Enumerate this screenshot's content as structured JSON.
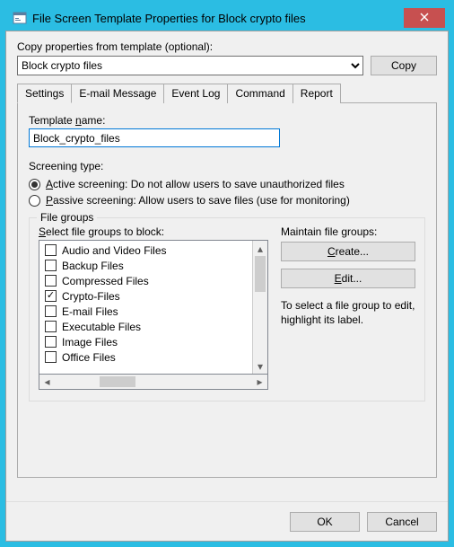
{
  "title": "File Screen Template Properties for Block crypto files",
  "copy_section": {
    "label": "Copy properties from template (optional):",
    "selected": "Block crypto files",
    "button": "Copy"
  },
  "tabs": [
    "Settings",
    "E-mail Message",
    "Event Log",
    "Command",
    "Report"
  ],
  "active_tab": "Settings",
  "settings": {
    "template_name_label": "Template name:",
    "template_name_value": "Block_crypto_files",
    "screening_type_label": "Screening type:",
    "active_label": "Active screening: Do not allow users to save unauthorized files",
    "passive_label": "Passive screening: Allow users to save files (use for monitoring)",
    "screening_selected": "active",
    "file_groups_legend": "File groups",
    "select_file_groups_label": "Select file groups to block:",
    "file_groups": [
      {
        "label": "Audio and Video Files",
        "checked": false
      },
      {
        "label": "Backup Files",
        "checked": false
      },
      {
        "label": "Compressed Files",
        "checked": false
      },
      {
        "label": "Crypto-Files",
        "checked": true
      },
      {
        "label": "E-mail Files",
        "checked": false
      },
      {
        "label": "Executable Files",
        "checked": false
      },
      {
        "label": "Image Files",
        "checked": false
      },
      {
        "label": "Office Files",
        "checked": false
      }
    ],
    "maintain_label": "Maintain file groups:",
    "create_button": "Create...",
    "edit_button": "Edit...",
    "help_text": "To select a file group to edit, highlight its label."
  },
  "dialog_buttons": {
    "ok": "OK",
    "cancel": "Cancel"
  }
}
